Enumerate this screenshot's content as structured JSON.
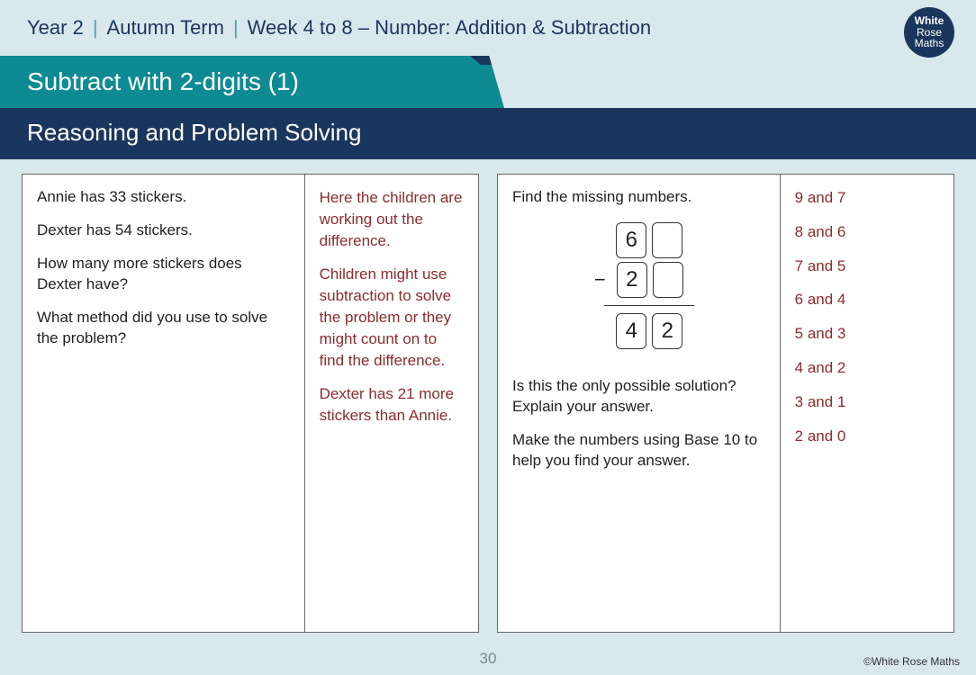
{
  "breadcrumb": {
    "year": "Year 2",
    "term": "Autumn Term",
    "weeks": "Week 4 to 8 – Number: Addition & Subtraction"
  },
  "logo": {
    "l1": "White",
    "l2": "Rose",
    "l3": "Maths"
  },
  "title": "Subtract with 2-digits (1)",
  "subtitle": "Reasoning and Problem Solving",
  "left": {
    "q1": "Annie has 33 stickers.",
    "q2": "Dexter has 54 stickers.",
    "q3": "How many more stickers does Dexter have?",
    "q4": "What method did you use to solve the problem?",
    "a1": "Here the children are working out the difference.",
    "a2": "Children might use subtraction to solve the problem or they might count on to find the difference.",
    "a3": "Dexter has 21 more stickers than Annie."
  },
  "right": {
    "q1": "Find the missing numbers.",
    "sum": {
      "top_tens": "6",
      "top_ones": "",
      "mid_tens": "2",
      "mid_ones": "",
      "res_tens": "4",
      "res_ones": "2",
      "op": "−"
    },
    "q2": "Is this the only possible solution? Explain your answer.",
    "q3": "Make the numbers using Base 10 to help you find your answer.",
    "answers": [
      "9 and 7",
      "8 and 6",
      "7 and 5",
      "6 and 4",
      "5 and 3",
      "4 and 2",
      "3 and 1",
      "2 and 0"
    ]
  },
  "page_number": "30",
  "copyright": "©White Rose Maths"
}
